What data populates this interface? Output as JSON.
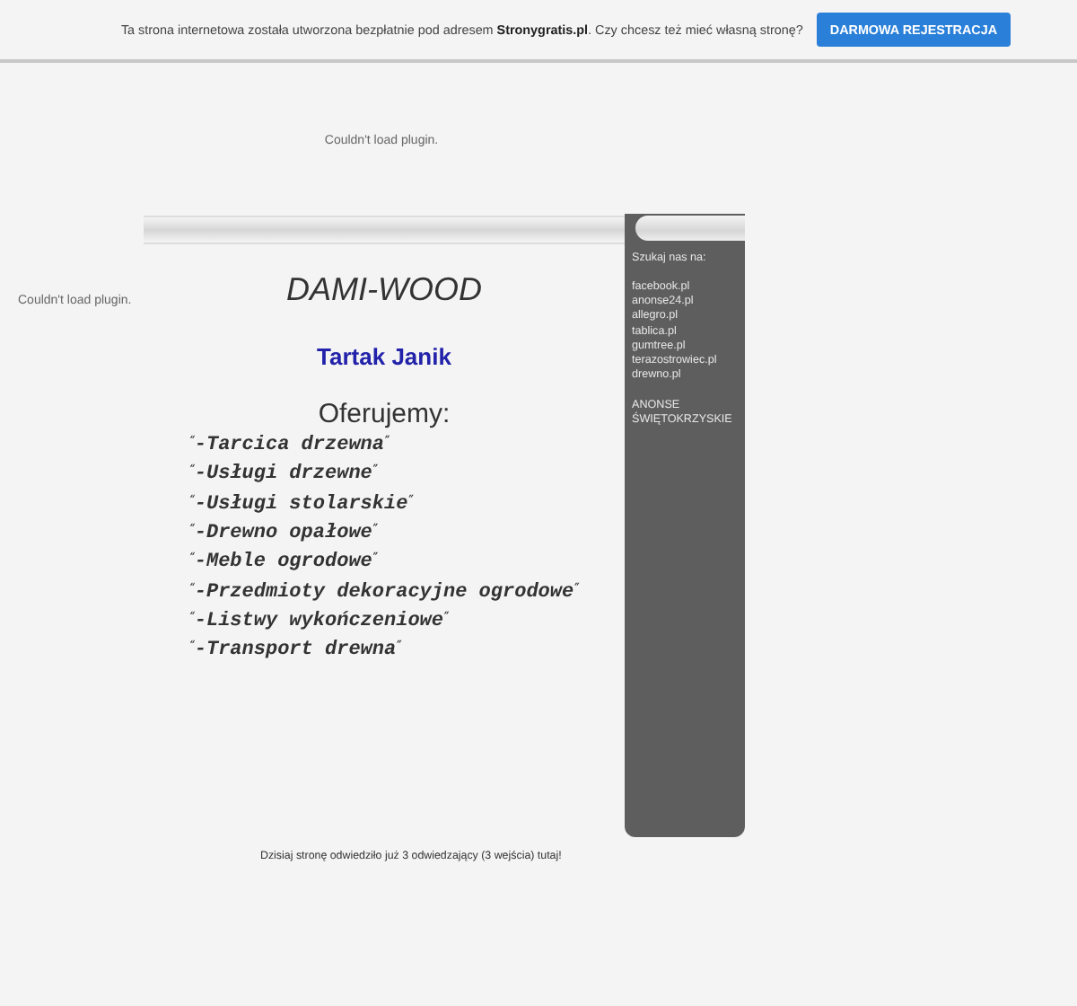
{
  "top_bar": {
    "notice": "Ta strona internetowa została utworzona bezpłatnie pod adresem **Stronygratis.pl**. Czy chcesz też mieć własną stronę?",
    "button": "DARMOWA REJESTRACJA"
  },
  "plugin_messages": [
    "Couldn't load plugin.",
    "Couldn't load plugin."
  ],
  "content": {
    "title": "DAMI-WOOD",
    "subtitle": "Tartak Janik",
    "offer_heading": "Oferujemy:",
    "offers": [
      {
        "open": "“",
        "text": "-Tarcica drzewna",
        "close": "”"
      },
      {
        "open": "“",
        "text": "-Usługi drzewne",
        "close": "”"
      },
      {
        "open": "“",
        "text": "-Usługi stolarskie",
        "close": "”"
      },
      {
        "open": "“",
        "text": "-Drewno opałowe",
        "close": "”"
      },
      {
        "open": "“",
        "text": "-Meble ogrodowe",
        "close": "”"
      },
      {
        "open": "“",
        "text": "-Przedmioty dekoracyjne ogrodowe",
        "close": "”"
      },
      {
        "open": "“",
        "text": "-Listwy wykończeniowe",
        "close": "”"
      },
      {
        "open": "“",
        "text": "-Transport drewna",
        "close": "”"
      }
    ]
  },
  "sidebar": {
    "heading": "Szukaj nas na:",
    "links": [
      "facebook.pl",
      "anonse24.pl",
      "allegro.pl",
      "tablica.pl",
      "gumtree.pl",
      "terazostrowiec.pl",
      "drewno.pl"
    ],
    "footer": "ANONSE ŚWIĘTOKRZYSKIE"
  },
  "visit_counter": "Dzisiaj stronę odwiedziło już 3 odwiedzający (3 wejścia) tutaj!"
}
